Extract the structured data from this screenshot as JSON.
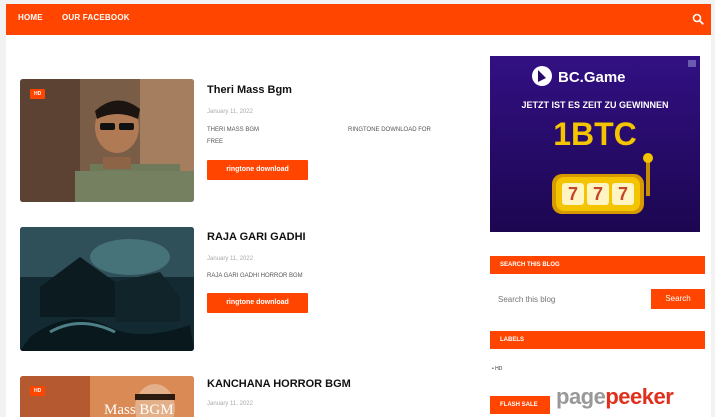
{
  "nav": {
    "home": "HOME",
    "facebook": "OUR FACEBOOK"
  },
  "posts": [
    {
      "tag": "HD",
      "title": "Theri Mass Bgm",
      "date": "January 11, 2022",
      "snippet_left": "THERI MASS BGM",
      "snippet_right": "RINGTONE DOWNLOAD FOR",
      "snippet_line2": "FREE",
      "button": "ringtone download"
    },
    {
      "title": "RAJA GARI GADHI",
      "date": "January 11, 2022",
      "snippet_left": "RAJA GARI GADHI HORROR BGM",
      "button": "ringtone download"
    },
    {
      "tag": "HD",
      "title": "KANCHANA HORROR BGM",
      "date": "January 11, 2022",
      "thumb_text": "Mass BGM"
    }
  ],
  "sidebar": {
    "ad": {
      "brand": "BC.Game",
      "headline": "JETZT IST ES ZEIT ZU GEWINNEN",
      "amount": "1BTC",
      "reels": [
        "7",
        "7",
        "7"
      ]
    },
    "search_header": "SEARCH THIS BLOG",
    "search_placeholder": "Search this blog",
    "search_button": "Search",
    "labels_header": "LABELS",
    "label_item": "• HD",
    "flash_header": "FLASH SALE"
  },
  "watermark": {
    "part1": "page",
    "part2": "peeker"
  },
  "colors": {
    "accent": "#ff4500",
    "ad_bg": "#2a0a68",
    "gold": "#f5c400"
  }
}
